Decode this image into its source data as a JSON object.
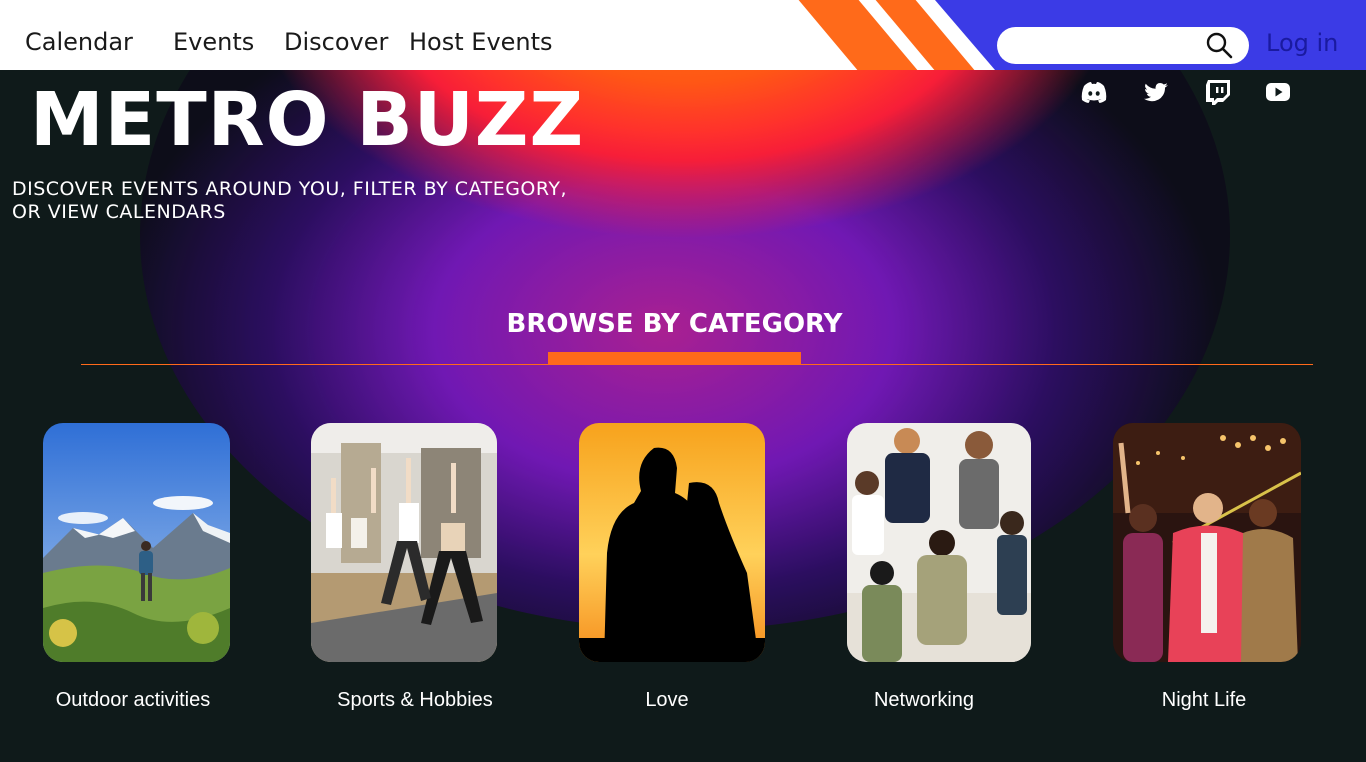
{
  "nav": {
    "calendar": "Calendar",
    "events": "Events",
    "discover": "Discover",
    "host_events": "Host Events",
    "login": "Log in",
    "search_placeholder": ""
  },
  "hero": {
    "title": "METRO BUZZ",
    "subtitle_line1": "DISCOVER EVENTS AROUND YOU, FILTER BY CATEGORY,",
    "subtitle_line2": "OR VIEW CALENDARS"
  },
  "section": {
    "title": "BROWSE BY CATEGORY"
  },
  "categories": [
    {
      "label": "Outdoor activities"
    },
    {
      "label": "Sports & Hobbies"
    },
    {
      "label": "Love"
    },
    {
      "label": "Networking"
    },
    {
      "label": "Night Life"
    }
  ],
  "social": [
    "discord-icon",
    "twitter-icon",
    "twitch-icon",
    "youtube-icon"
  ],
  "colors": {
    "accent_orange": "#ff6a1a",
    "header_blue": "#3b3be6",
    "background": "#0f1a1a"
  }
}
